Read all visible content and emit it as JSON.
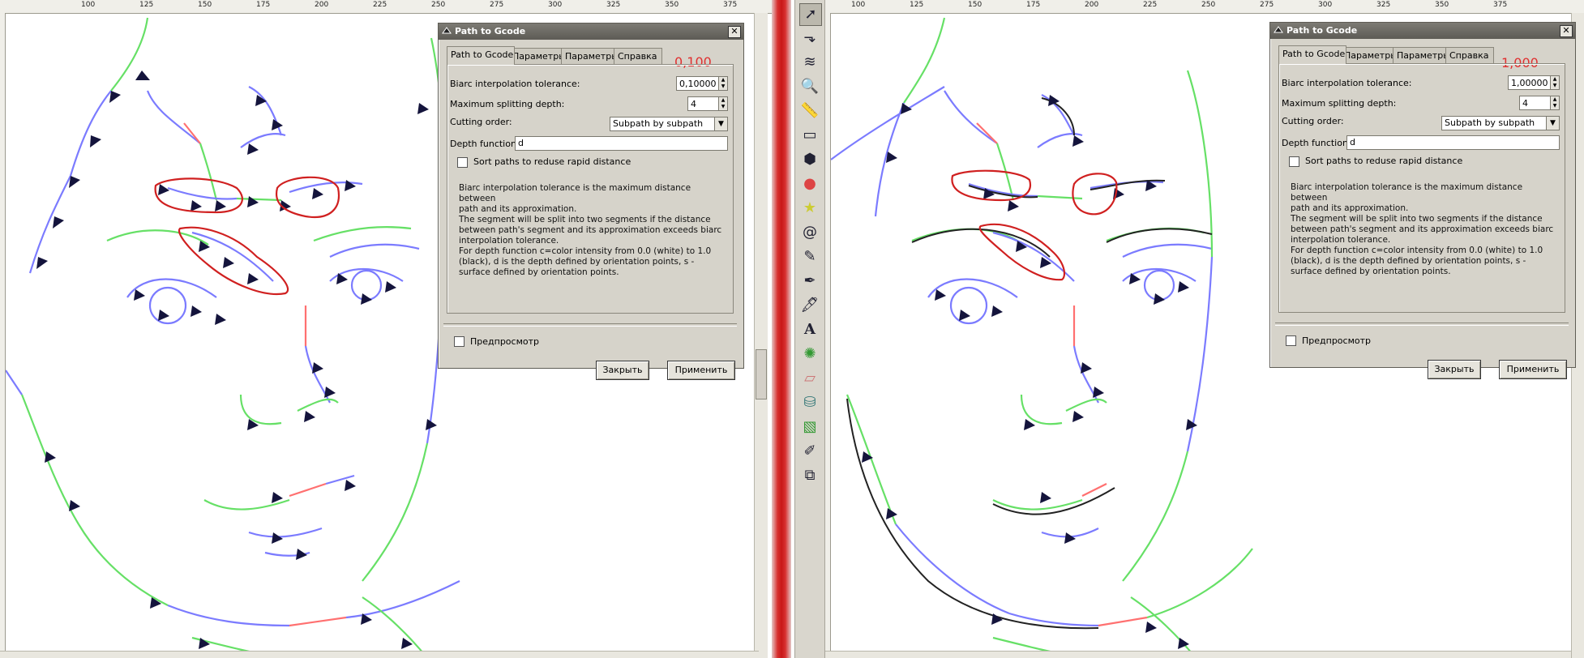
{
  "left_pane": {
    "ruler_ticks": [
      "100",
      "125",
      "150",
      "175",
      "200",
      "225",
      "250",
      "275",
      "300",
      "325",
      "350",
      "375"
    ]
  },
  "right_pane": {
    "ruler_ticks": [
      "100",
      "125",
      "150",
      "175",
      "200",
      "225",
      "250",
      "275",
      "300",
      "325",
      "350",
      "375"
    ]
  },
  "toolbox": {
    "tools": [
      "selector-tool",
      "node-tool",
      "tweak-tool",
      "zoom-tool",
      "measure-tool",
      "rectangle-tool",
      "box-3d-tool",
      "ellipse-tool",
      "star-tool",
      "spiral-tool",
      "pencil-tool",
      "pen-tool",
      "calligraphy-tool",
      "text-tool",
      "spray-tool",
      "eraser-tool",
      "paint-bucket-tool",
      "gradient-tool",
      "dropper-tool",
      "connector-tool"
    ]
  },
  "dialog_left": {
    "title": "Path to Gcode",
    "tabs": [
      "Path to Gcode",
      "Параметры",
      "Параметры",
      "Справка"
    ],
    "annotation": "0,100",
    "fields": {
      "biarc_label": "Biarc interpolation tolerance:",
      "biarc_value": "0,10000",
      "depth_label": "Maximum splitting depth:",
      "depth_value": "4",
      "cutting_label": "Cutting order:",
      "cutting_value": "Subpath by subpath",
      "depthfn_label": "Depth function:",
      "depthfn_value": "d",
      "sort_label": "Sort paths to reduse rapid distance"
    },
    "help_lines": [
      "Biarc interpolation tolerance is the maximum distance between",
      "path and its approximation.",
      "The segment will be split into two segments if the distance",
      "between path's segment and its approximation exceeds biarc",
      "interpolation tolerance.",
      "For depth function c=color intensity from 0.0 (white) to 1.0",
      "(black), d is the depth defined by orientation points, s -",
      "surface defined by orientation points."
    ],
    "preview_label": "Предпросмотр",
    "close_button": "Закрыть",
    "apply_button": "Применить"
  },
  "dialog_right": {
    "title": "Path to Gcode",
    "tabs": [
      "Path to Gcode",
      "Параметры",
      "Параметры",
      "Справка"
    ],
    "annotation": "1,000",
    "fields": {
      "biarc_label": "Biarc interpolation tolerance:",
      "biarc_value": "1,00000",
      "depth_label": "Maximum splitting depth:",
      "depth_value": "4",
      "cutting_label": "Cutting order:",
      "cutting_value": "Subpath by subpath",
      "depthfn_label": "Depth function:",
      "depthfn_value": "d",
      "sort_label": "Sort paths to reduse rapid distance"
    },
    "help_lines": [
      "Biarc interpolation tolerance is the maximum distance between",
      "path and its approximation.",
      "The segment will be split into two segments if the distance",
      "between path's segment and its approximation exceeds biarc",
      "interpolation tolerance.",
      "For depth function c=color intensity from 0.0 (white) to 1.0",
      "(black), d is the depth defined by orientation points, s -",
      "surface defined by orientation points."
    ],
    "preview_label": "Предпросмотр",
    "close_button": "Закрыть",
    "apply_button": "Применить"
  },
  "colors": {
    "path_blue": "#7b7bff",
    "path_green": "#66e066",
    "path_red": "#ff7070",
    "arrow": "#14143c",
    "highlight_red": "#d02020"
  }
}
